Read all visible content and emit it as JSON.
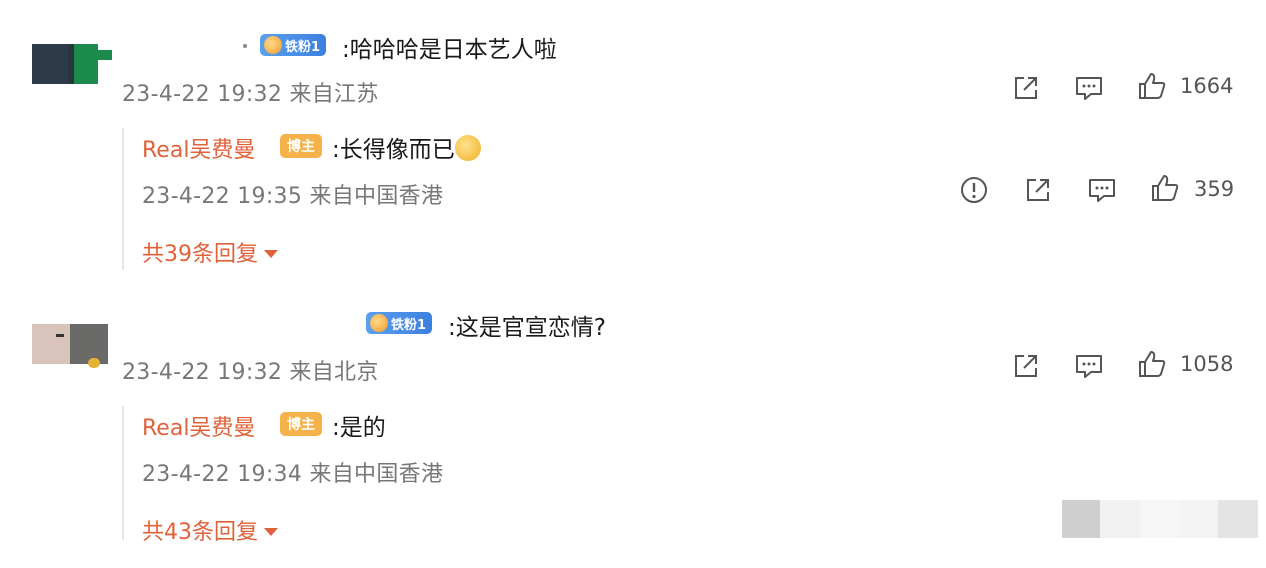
{
  "comments": [
    {
      "text": ":哈哈哈是日本艺人啦",
      "fan_badge": "铁粉1",
      "meta": "23-4-22 19:32 来自江苏",
      "like_count": "1664",
      "reply": {
        "name": "Real吴费曼",
        "host_badge": "博主",
        "text": ":长得像而已",
        "meta": "23-4-22 19:35 来自中国香港",
        "like_count": "359"
      },
      "more_replies": "共39条回复"
    },
    {
      "text": ":这是官宣恋情?",
      "fan_badge": "铁粉1",
      "meta": "23-4-22 19:32 来自北京",
      "like_count": "1058",
      "reply": {
        "name": "Real吴费曼",
        "host_badge": "博主",
        "text": ":是的",
        "meta": "23-4-22 19:34 来自中国香港"
      },
      "more_replies": "共43条回复"
    }
  ],
  "colors": {
    "accent": "#e0623a",
    "meta_gray": "#777777",
    "host_badge": "#f6b24a",
    "fan_badge": "#3c7fe0"
  },
  "icons": [
    "share-icon",
    "comment-icon",
    "like-icon",
    "report-icon",
    "caret-down-icon",
    "crown-icon",
    "smiley-icon"
  ]
}
